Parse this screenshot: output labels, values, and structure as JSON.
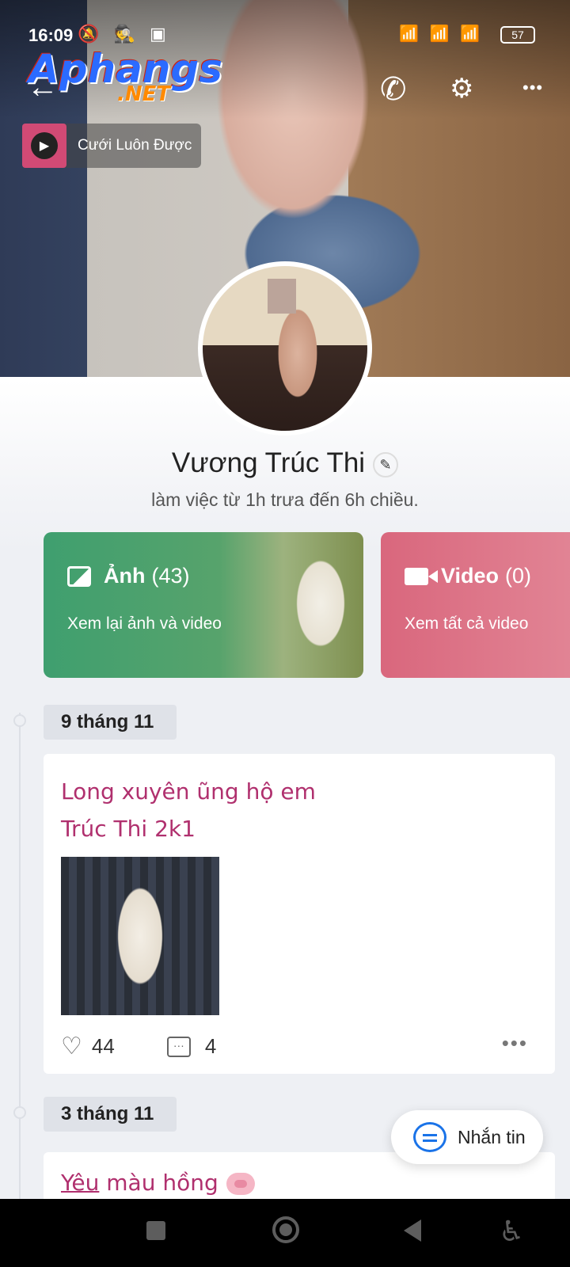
{
  "status_bar": {
    "time": "16:09",
    "battery": "57",
    "left_icons": "🔕 🕵 ▣",
    "right_icons": "📶 📶 📶"
  },
  "watermark": {
    "main": "Aphangs",
    "sub": ".NET"
  },
  "header": {
    "back_glyph": "←",
    "call_glyph": "✆",
    "settings_glyph": "⚙",
    "more_glyph": "•••"
  },
  "music": {
    "label": "Cưới Luôn Được",
    "play_glyph": "▶"
  },
  "profile": {
    "name": "Vương Trúc Thi",
    "edit_glyph": "✎",
    "bio": "làm việc từ 1h trưa đến 6h chiều."
  },
  "cards": {
    "photos": {
      "label": "Ảnh",
      "count": "(43)",
      "subtitle": "Xem lại ảnh và video"
    },
    "videos": {
      "label": "Video",
      "count": "(0)",
      "subtitle": "Xem tất cả video"
    }
  },
  "timeline": [
    {
      "date": "9 tháng 11",
      "line1": "Long xuyên ũng hộ em",
      "line2": "Trúc Thi 2k1",
      "likes": "44",
      "comments": "4",
      "heart_glyph": "♡",
      "more_glyph": "•••"
    },
    {
      "date": "3 tháng 11",
      "text_underlined": "Yêu",
      "text_rest": " màu hồng"
    }
  ],
  "fab": {
    "label": "Nhắn tin"
  },
  "nav": {
    "accessibility_glyph": "♿"
  },
  "colors": {
    "post_text": "#b0306e",
    "photo_card": "#3f9f6f",
    "video_card": "#d9677d",
    "accent": "#1a73e8"
  }
}
